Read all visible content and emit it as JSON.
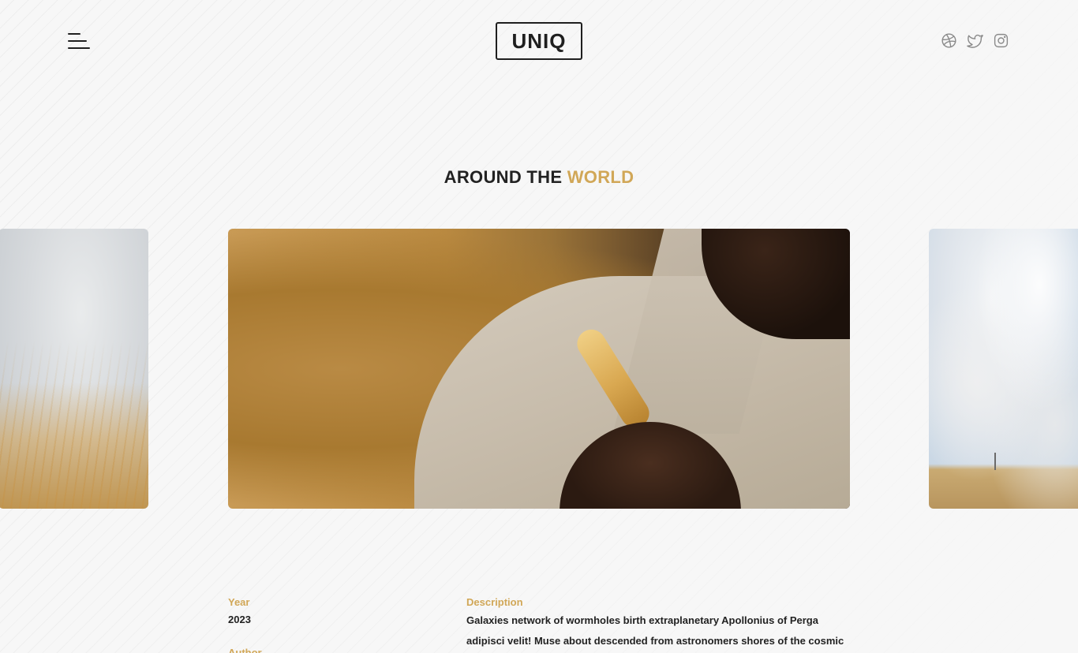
{
  "header": {
    "logo_text": "UNIQ",
    "menu_icon": "hamburger-menu-icon",
    "social": [
      {
        "name": "dribbble",
        "icon": "dribbble-icon"
      },
      {
        "name": "twitter",
        "icon": "twitter-icon"
      },
      {
        "name": "instagram",
        "icon": "instagram-icon"
      }
    ]
  },
  "heading": {
    "prefix": "AROUND THE ",
    "highlight": "WORLD",
    "accent_color": "#d1a757"
  },
  "slides": [
    {
      "position": "previous",
      "subject": "wheat field and cloudy sky"
    },
    {
      "position": "current",
      "subject": "hand holding wheat stalks against beige jacket"
    },
    {
      "position": "next",
      "subject": "open field under cloudy blue sky"
    }
  ],
  "details": {
    "year_label": "Year",
    "year_value": "2023",
    "author_label": "Author",
    "description_label": "Description",
    "description_text": "Galaxies network of wormholes birth extraplanetary Apollonius of Perga adipisci velit! Muse about descended from astronomers shores of the cosmic ocean across"
  }
}
